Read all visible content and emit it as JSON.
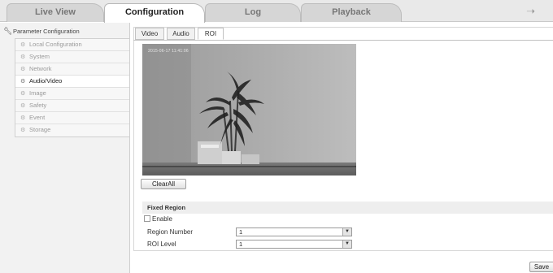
{
  "top_tabs": [
    {
      "label": "Live View",
      "active": false
    },
    {
      "label": "Configuration",
      "active": true
    },
    {
      "label": "Log",
      "active": false
    },
    {
      "label": "Playback",
      "active": false
    }
  ],
  "logout_icon": "arrow-right-icon",
  "sidebar": {
    "header": "Parameter Configuration",
    "header_icon": "wrench-icon",
    "items": [
      {
        "label": "Local Configuration",
        "active": false
      },
      {
        "label": "System",
        "active": false
      },
      {
        "label": "Network",
        "active": false
      },
      {
        "label": "Audio/Video",
        "active": true
      },
      {
        "label": "Image",
        "active": false
      },
      {
        "label": "Safety",
        "active": false
      },
      {
        "label": "Event",
        "active": false
      },
      {
        "label": "Storage",
        "active": false
      }
    ]
  },
  "sub_tabs": [
    {
      "label": "Video",
      "active": false
    },
    {
      "label": "Audio",
      "active": false
    },
    {
      "label": "ROI",
      "active": true
    }
  ],
  "video": {
    "osd_timestamp": "2015-06-17 11:41:06"
  },
  "clear_all_label": "ClearAll",
  "fixed_region": {
    "title": "Fixed Region",
    "enable_label": "Enable",
    "enable_checked": false,
    "region_number_label": "Region Number",
    "region_number_value": "1",
    "roi_level_label": "ROI Level",
    "roi_level_value": "1"
  },
  "save_label": "Save",
  "colors": {
    "active_tab_bg": "#ffffff",
    "inactive_tab_bg": "#d6d6d6",
    "panel_bg": "#f2f2f2"
  }
}
